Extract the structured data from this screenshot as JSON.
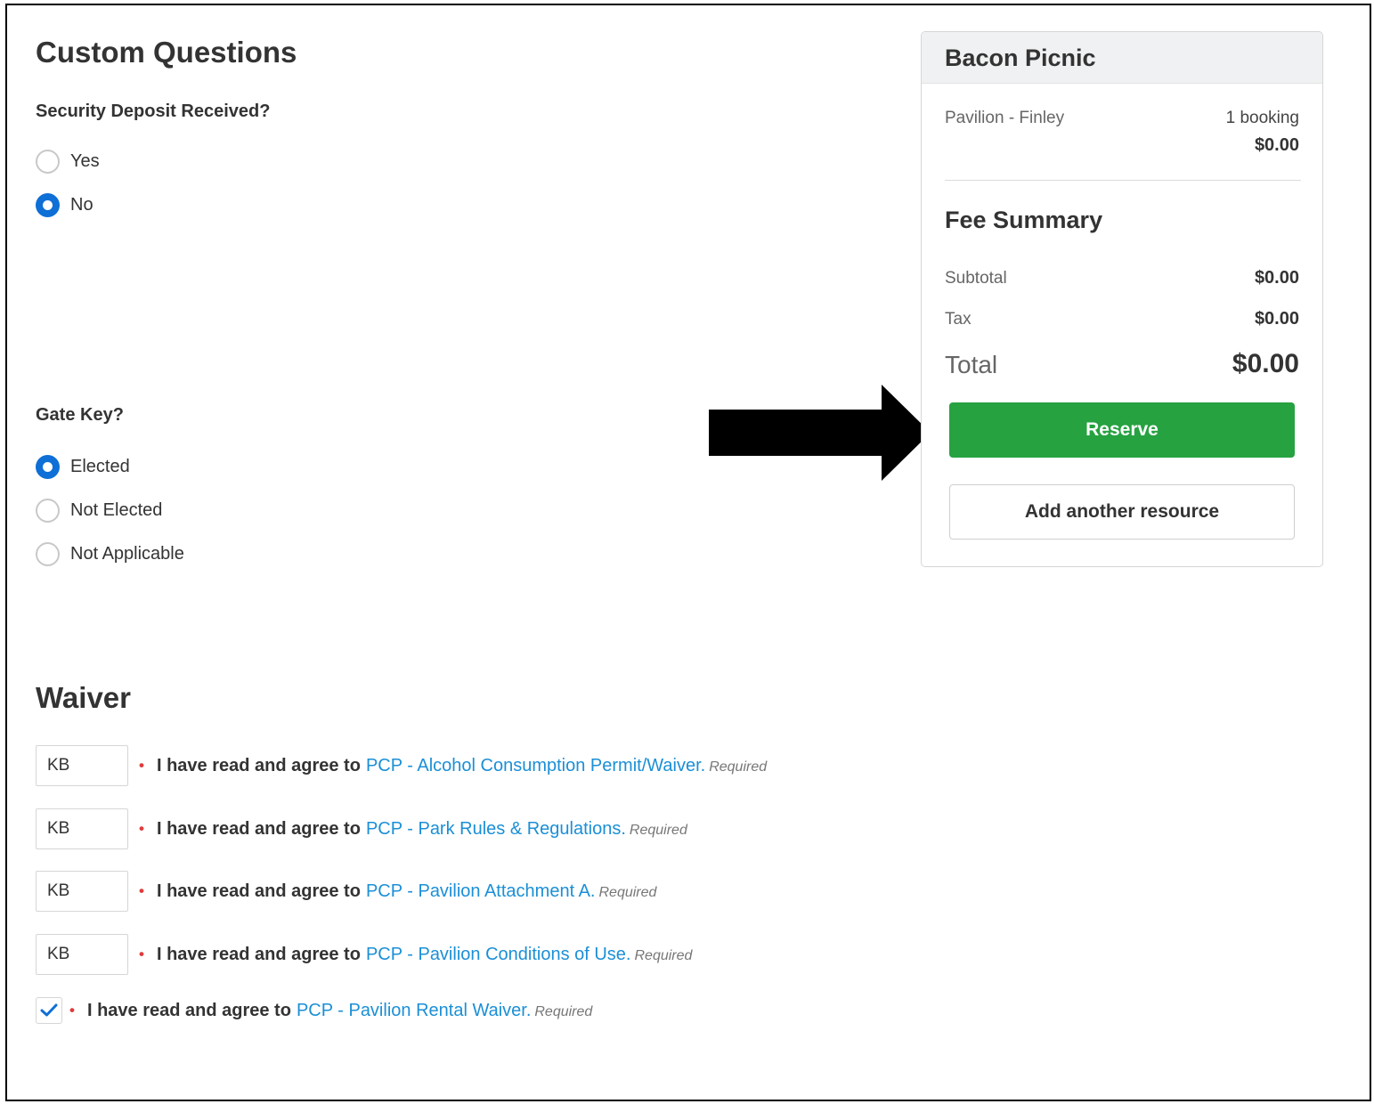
{
  "custom_questions": {
    "title": "Custom Questions",
    "security_deposit": {
      "label": "Security Deposit Received?",
      "options": [
        {
          "label": "Yes",
          "selected": false
        },
        {
          "label": "No",
          "selected": true
        }
      ]
    },
    "gate_key": {
      "label": "Gate Key?",
      "options": [
        {
          "label": "Elected",
          "selected": true
        },
        {
          "label": "Not Elected",
          "selected": false
        },
        {
          "label": "Not Applicable",
          "selected": false
        }
      ]
    }
  },
  "waiver": {
    "title": "Waiver",
    "agree_prefix": "I have read and agree to",
    "required_label": "Required",
    "items": [
      {
        "initials": "KB",
        "link": "PCP - Alcohol Consumption Permit/Waiver."
      },
      {
        "initials": "KB",
        "link": "PCP - Park Rules & Regulations."
      },
      {
        "initials": "KB",
        "link": "PCP - Pavilion Attachment A."
      },
      {
        "initials": "KB",
        "link": "PCP - Pavilion Conditions of Use."
      }
    ],
    "checkbox_item": {
      "checked": true,
      "link": "PCP - Pavilion Rental Waiver."
    }
  },
  "summary": {
    "title": "Bacon Picnic",
    "resource": "Pavilion - Finley",
    "bookings": "1 booking",
    "resource_amount": "$0.00",
    "fee_summary_title": "Fee Summary",
    "subtotal_label": "Subtotal",
    "subtotal": "$0.00",
    "tax_label": "Tax",
    "tax": "$0.00",
    "total_label": "Total",
    "total": "$0.00",
    "reserve_label": "Reserve",
    "add_resource_label": "Add another resource"
  },
  "colors": {
    "accent_blue": "#0e6fd6",
    "link_blue": "#1b8fd6",
    "reserve_green": "#26a241",
    "required_red": "#e03b3b"
  },
  "icons": [
    "arrow-right-icon",
    "checkmark-icon"
  ]
}
